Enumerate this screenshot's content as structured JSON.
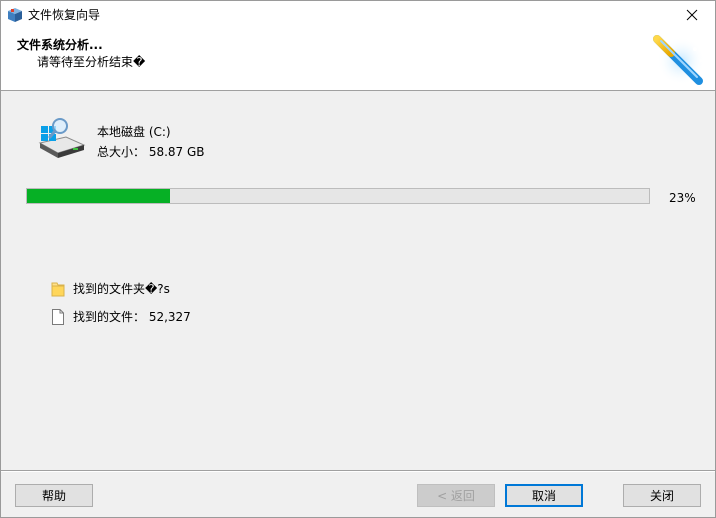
{
  "window": {
    "title": "文件恢复向导"
  },
  "header": {
    "title": "文件系统分析...",
    "subtitle": "请等待至分析结束�"
  },
  "drive": {
    "name": "本地磁盘 (C:)",
    "size_text": "总大小： 58.87 GB"
  },
  "progress": {
    "percent_value": 23,
    "percent_text": "23%",
    "fill_color": "#06b025"
  },
  "found": {
    "folders_text": "找到的文件夹�?s",
    "files_text": "找到的文件： 52,327"
  },
  "buttons": {
    "help": "帮助",
    "back": "< 返回",
    "cancel": "取消",
    "close": "关闭"
  },
  "icons": {
    "app": "app-box-icon",
    "close": "close-icon",
    "wand": "magic-wand-icon",
    "drive": "drive-icon",
    "folder": "folder-icon",
    "file": "file-icon"
  }
}
